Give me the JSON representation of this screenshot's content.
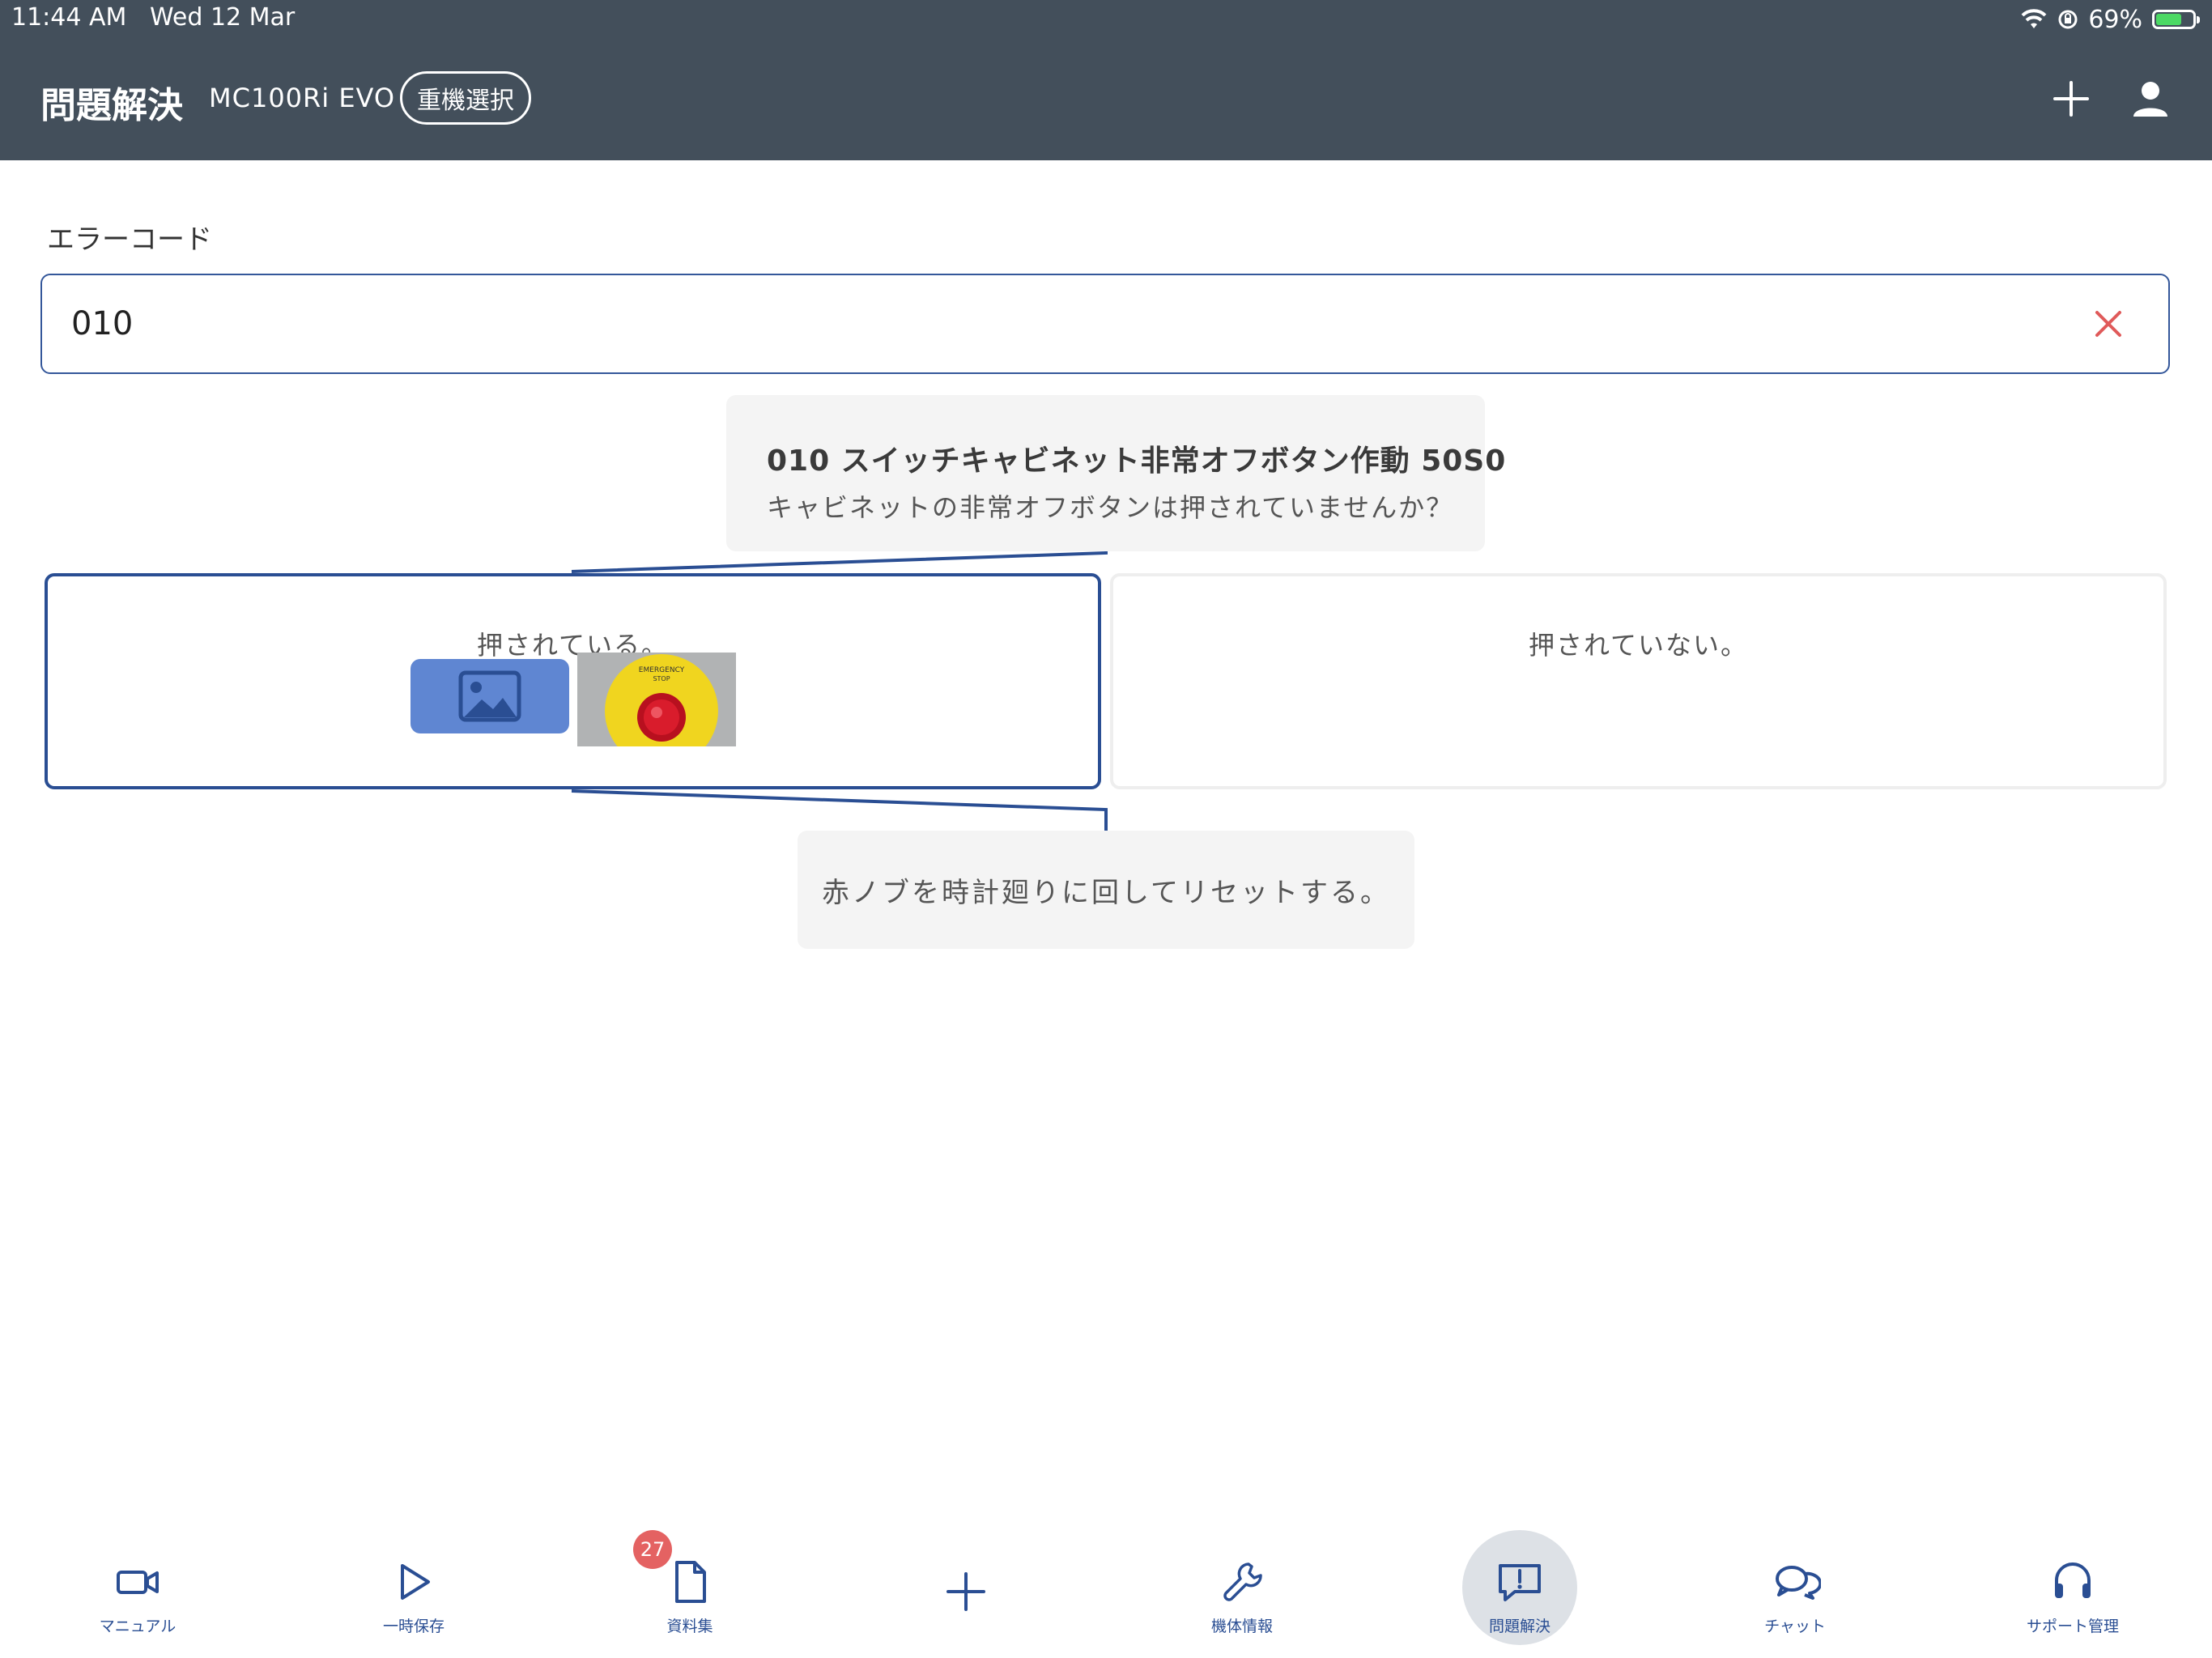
{
  "status_bar": {
    "time": "11:44 AM",
    "date": "Wed 12 Mar",
    "battery": "69%",
    "battery_level": 0.69
  },
  "header": {
    "title": "問題解決",
    "machine": "MC100Ri EVO",
    "machine_select_label": "重機選択",
    "add_icon": "plus-icon",
    "user_icon": "person-icon"
  },
  "error_code": {
    "label": "エラーコード",
    "value": "010",
    "clear_icon": "close-icon"
  },
  "question": {
    "title": "010 スイッチキャビネット非常オフボタン作動 50S0",
    "text": "キャビネットの非常オフボタンは押されていませんか？"
  },
  "answers": [
    {
      "label": "押されている。",
      "selected": true
    },
    {
      "label": "押されていない。",
      "selected": false
    }
  ],
  "stop_button_photo": {
    "text_top": "EMERGENCY",
    "text_bottom": "STOP"
  },
  "result": {
    "text": "赤ノブを時計廻りに回してリセットする。"
  },
  "bottom_nav": [
    {
      "label": "マニュアル",
      "icon": "video-camera-icon"
    },
    {
      "label": "一時保存",
      "icon": "play-icon"
    },
    {
      "label": "資料集",
      "icon": "document-icon",
      "badge": "27"
    },
    {
      "label": "",
      "icon": "plus-icon"
    },
    {
      "label": "機体情報",
      "icon": "wrench-icon"
    },
    {
      "label": "問題解決",
      "icon": "chat-alert-icon",
      "active": true
    },
    {
      "label": "チャット",
      "icon": "chat-bubbles-icon"
    },
    {
      "label": "サポート管理",
      "icon": "headset-icon"
    }
  ],
  "colors": {
    "header_bg": "#434f5b",
    "accent": "#2a4e93",
    "clear_red": "#e05a5a",
    "badge_red": "#e46262",
    "placeholder_blue": "#5f86d2"
  }
}
